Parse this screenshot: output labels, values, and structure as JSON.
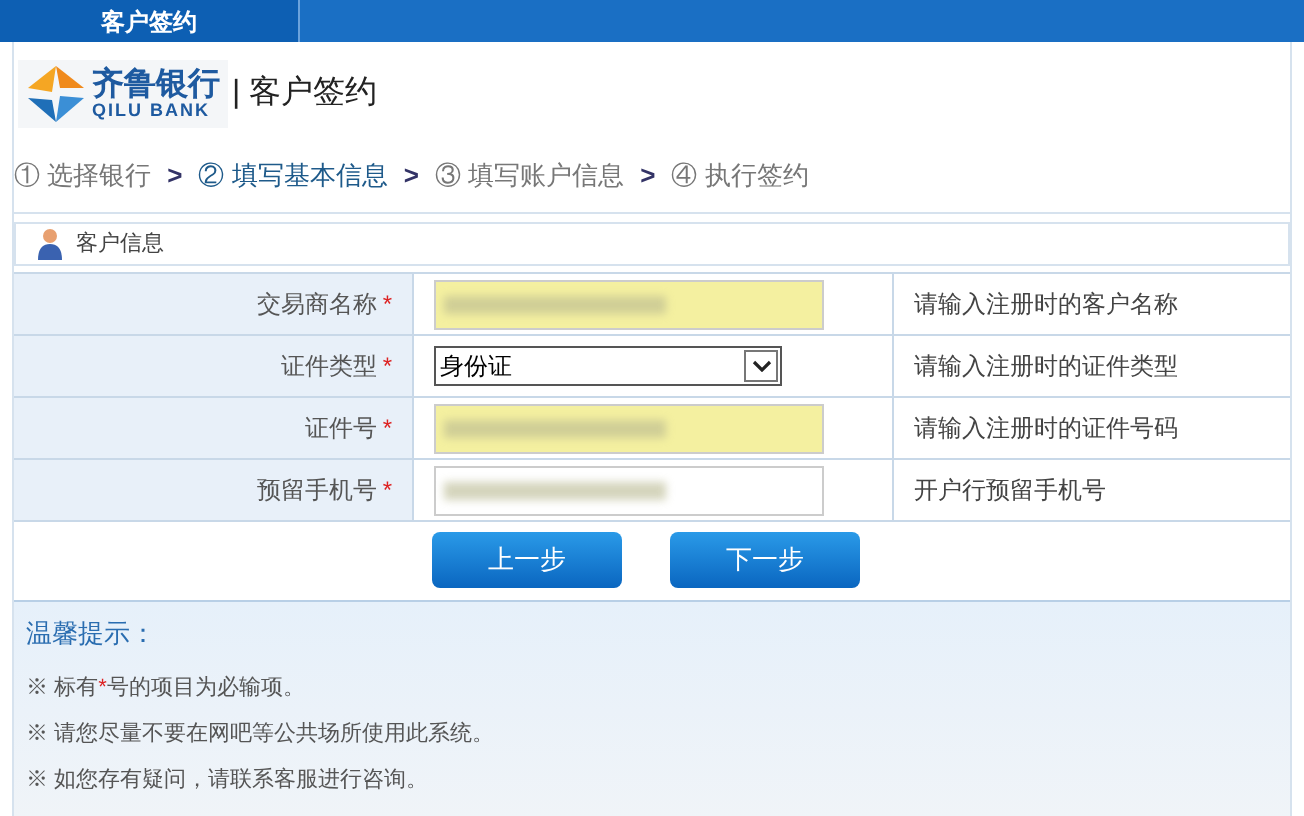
{
  "top_tab": {
    "label": "客户签约"
  },
  "logo": {
    "name": "齐鲁银行",
    "name_en": "QILU BANK"
  },
  "page_title": "| 客户签约",
  "steps": [
    {
      "label": "① 选择银行",
      "selected": false
    },
    {
      "label": "② 填写基本信息",
      "selected": true
    },
    {
      "label": "③ 填写账户信息",
      "selected": false
    },
    {
      "label": "④ 执行签约",
      "selected": false
    }
  ],
  "step_separator": ">",
  "panel": {
    "title": "客户信息"
  },
  "fields": [
    {
      "kind": "text",
      "label": "交易商名称",
      "required": true,
      "highlighted": true,
      "hint": "请输入注册时的客户名称"
    },
    {
      "kind": "select",
      "label": "证件类型",
      "required": true,
      "value": "身份证",
      "hint": "请输入注册时的证件类型"
    },
    {
      "kind": "text",
      "label": "证件号",
      "required": true,
      "highlighted": true,
      "hint": "请输入注册时的证件号码"
    },
    {
      "kind": "text",
      "label": "预留手机号",
      "required": true,
      "highlighted": false,
      "hint": "开户行预留手机号"
    }
  ],
  "required_mark": "*",
  "buttons": [
    "上一步",
    "下一步"
  ],
  "tips": {
    "title": "温馨提示：",
    "items": [
      {
        "text": "※ 标有 ",
        "mark": "*",
        "after": " 号的项目为必输项。"
      },
      {
        "text": "※ 请您尽量不要在网吧等公共场所使用此系统。"
      },
      {
        "text": "※ 如您存有疑问，请联系客服进行咨询。"
      }
    ]
  }
}
